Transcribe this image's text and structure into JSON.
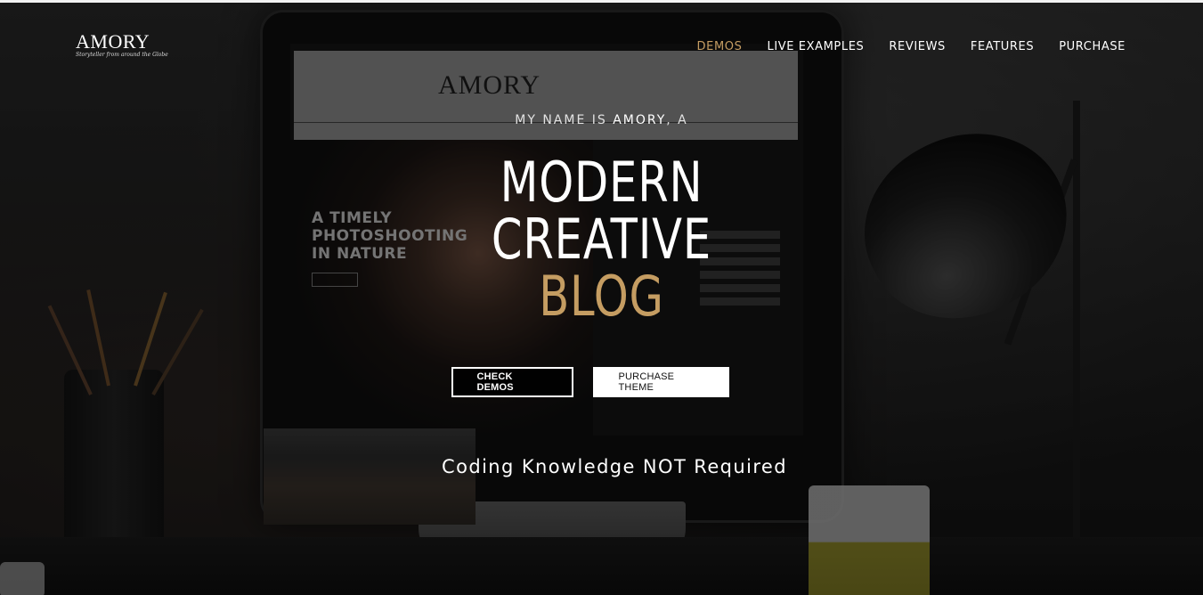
{
  "brand": {
    "name": "AMORY",
    "tagline": "Storyteller from around the Globe"
  },
  "nav": {
    "items": [
      {
        "label": "DEMOS",
        "active": true
      },
      {
        "label": "LIVE EXAMPLES",
        "active": false
      },
      {
        "label": "REVIEWS",
        "active": false
      },
      {
        "label": "FEATURES",
        "active": false
      },
      {
        "label": "PURCHASE",
        "active": false
      }
    ]
  },
  "hero": {
    "intro_prefix": "MY NAME IS ",
    "intro_name": "AMORY",
    "intro_suffix": ", A",
    "title_line1": "MODERN",
    "title_line2": "CREATIVE",
    "title_line3": "BLOG",
    "primary_button": "CHECK DEMOS",
    "secondary_button": "PURCHASE THEME",
    "tagline": "Coding Knowledge NOT Required"
  },
  "screen_preview": {
    "logo": "AMORY",
    "headline": "A TIMELY PHOTOSHOOTING IN NATURE"
  },
  "colors": {
    "accent": "#c59d62",
    "text": "#ffffff",
    "background": "#1b1b1b"
  }
}
